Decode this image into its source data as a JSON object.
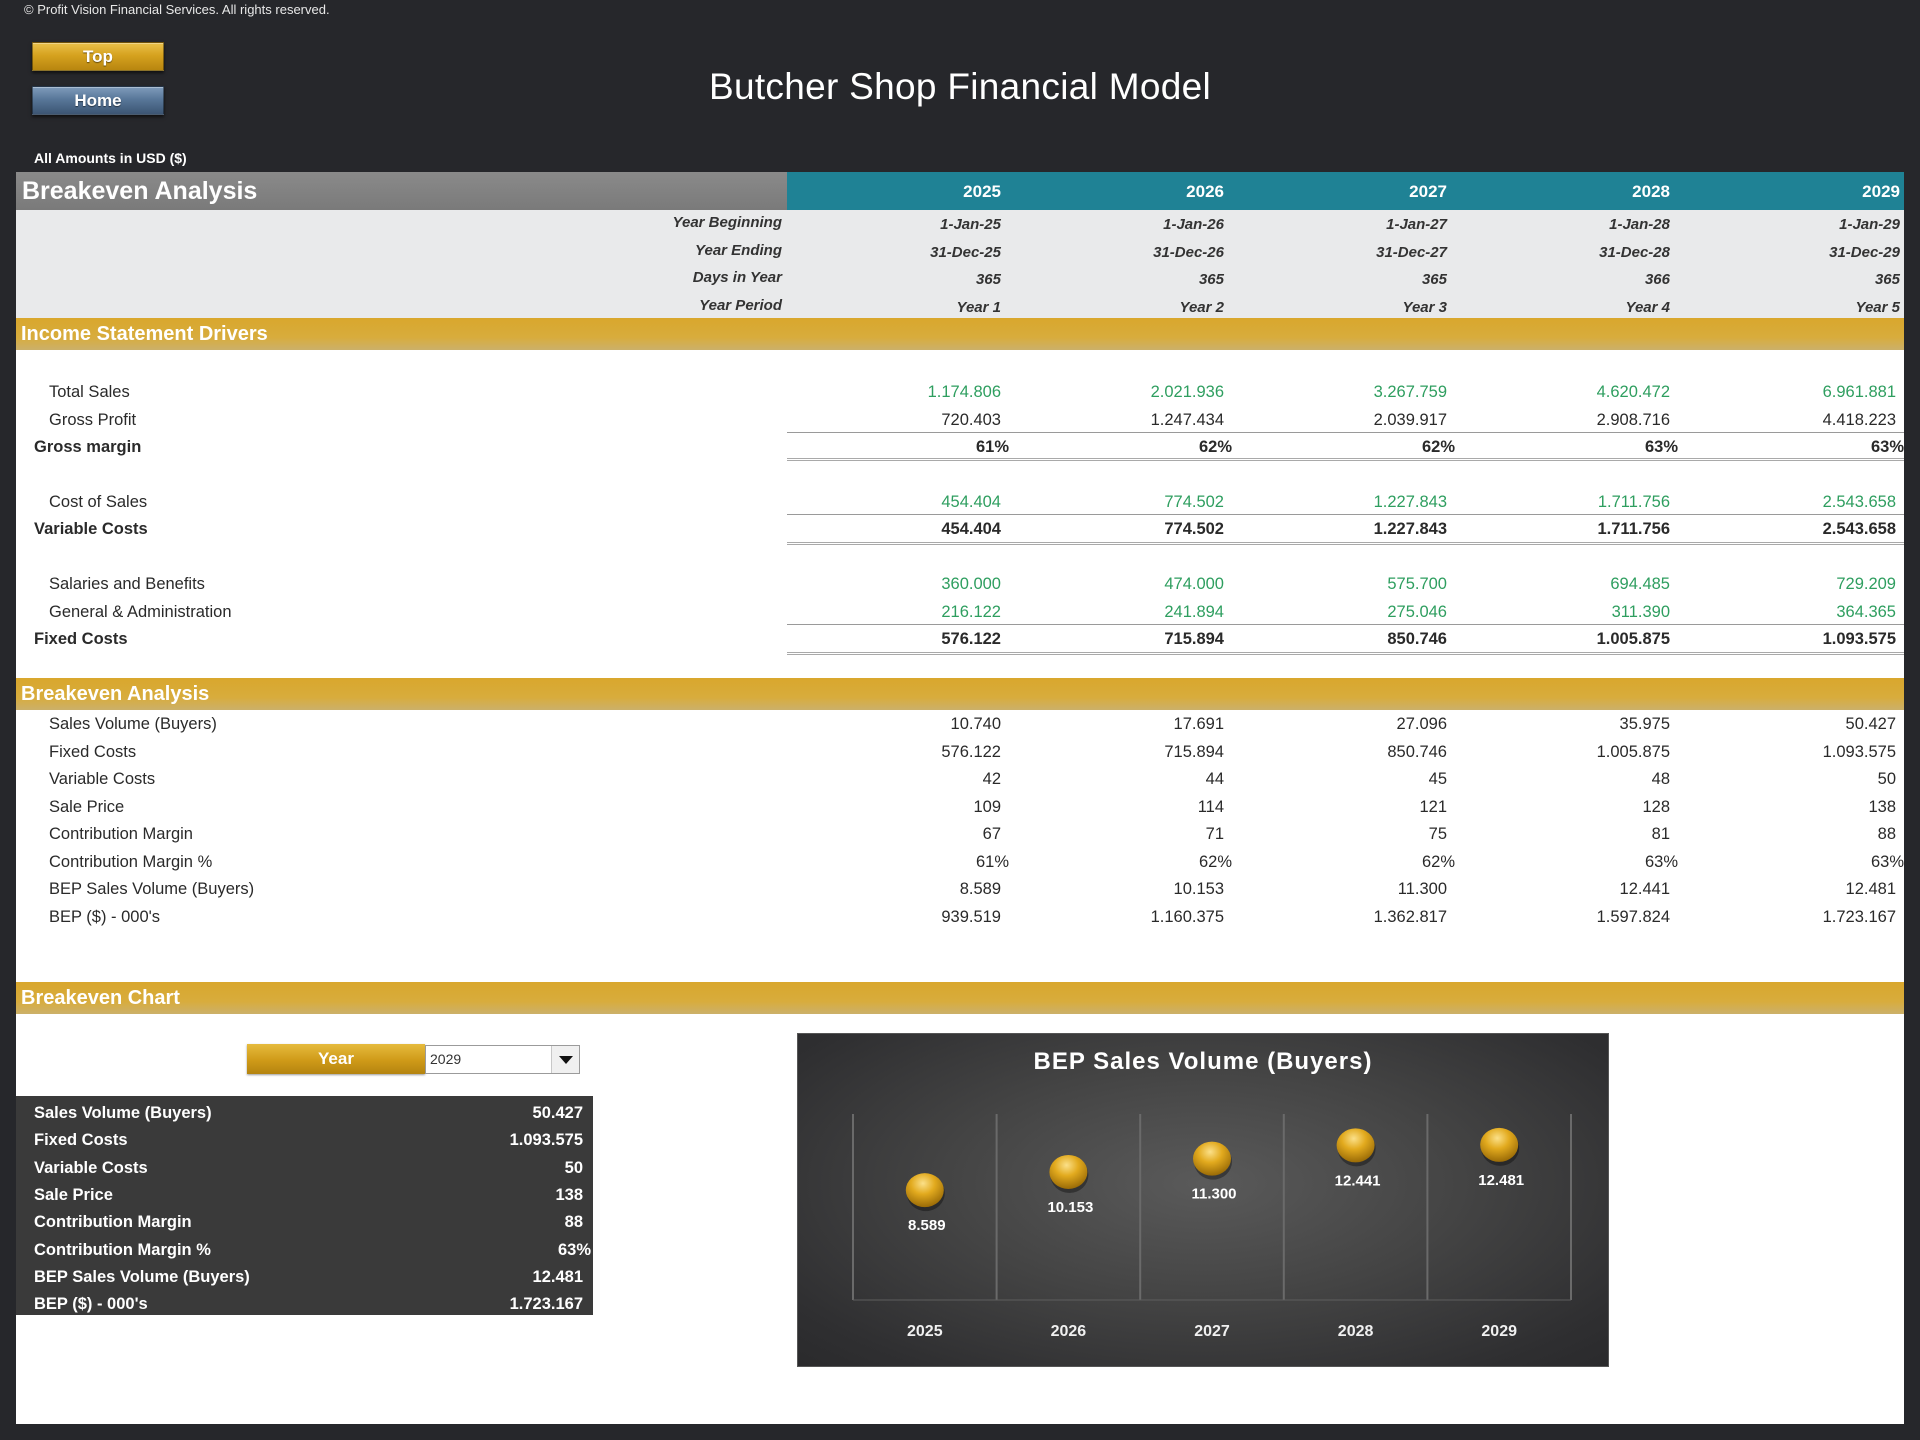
{
  "copyright": "© Profit Vision Financial Services. All rights reserved.",
  "nav": {
    "top_label": "Top",
    "home_label": "Home"
  },
  "title": "Butcher Shop Financial Model",
  "currency_note": "All Amounts in  USD ($)",
  "header": {
    "section_title": "Breakeven Analysis",
    "years": [
      "2025",
      "2026",
      "2027",
      "2028",
      "2029"
    ]
  },
  "period_info": [
    {
      "label": "Year Beginning",
      "values": [
        "1-Jan-25",
        "1-Jan-26",
        "1-Jan-27",
        "1-Jan-28",
        "1-Jan-29"
      ]
    },
    {
      "label": "Year Ending",
      "values": [
        "31-Dec-25",
        "31-Dec-26",
        "31-Dec-27",
        "31-Dec-28",
        "31-Dec-29"
      ]
    },
    {
      "label": "Days in Year",
      "values": [
        "365",
        "365",
        "365",
        "366",
        "365"
      ]
    },
    {
      "label": "Year Period",
      "values": [
        "Year 1",
        "Year 2",
        "Year 3",
        "Year 4",
        "Year 5"
      ]
    }
  ],
  "income_drivers": {
    "title": "Income Statement Drivers",
    "rows": [
      {
        "label": "Total Sales",
        "style": "input",
        "values": [
          "1.174.806",
          "2.021.936",
          "3.267.759",
          "4.620.472",
          "6.961.881"
        ]
      },
      {
        "label": "Gross Profit",
        "style": "normal",
        "values": [
          "720.403",
          "1.247.434",
          "2.039.917",
          "2.908.716",
          "4.418.223"
        ]
      },
      {
        "label": "Gross margin",
        "style": "total",
        "values": [
          "61%",
          "62%",
          "62%",
          "63%",
          "63%"
        ]
      },
      {
        "label": "Cost of Sales",
        "style": "input",
        "values": [
          "454.404",
          "774.502",
          "1.227.843",
          "1.711.756",
          "2.543.658"
        ]
      },
      {
        "label": "Variable Costs",
        "style": "total",
        "values": [
          "454.404",
          "774.502",
          "1.227.843",
          "1.711.756",
          "2.543.658"
        ]
      },
      {
        "label": "Salaries and Benefits",
        "style": "input",
        "values": [
          "360.000",
          "474.000",
          "575.700",
          "694.485",
          "729.209"
        ]
      },
      {
        "label": "General & Administration",
        "style": "input",
        "values": [
          "216.122",
          "241.894",
          "275.046",
          "311.390",
          "364.365"
        ]
      },
      {
        "label": "Fixed Costs",
        "style": "total",
        "values": [
          "576.122",
          "715.894",
          "850.746",
          "1.005.875",
          "1.093.575"
        ]
      }
    ]
  },
  "breakeven": {
    "title": "Breakeven Analysis",
    "rows": [
      {
        "label": "Sales Volume (Buyers)",
        "values": [
          "10.740",
          "17.691",
          "27.096",
          "35.975",
          "50.427"
        ]
      },
      {
        "label": "Fixed Costs",
        "values": [
          "576.122",
          "715.894",
          "850.746",
          "1.005.875",
          "1.093.575"
        ]
      },
      {
        "label": "Variable Costs",
        "values": [
          "42",
          "44",
          "45",
          "48",
          "50"
        ]
      },
      {
        "label": "Sale Price",
        "values": [
          "109",
          "114",
          "121",
          "128",
          "138"
        ]
      },
      {
        "label": "Contribution Margin",
        "values": [
          "67",
          "71",
          "75",
          "81",
          "88"
        ]
      },
      {
        "label": "Contribution Margin %",
        "values": [
          "61%",
          "62%",
          "62%",
          "63%",
          "63%"
        ]
      },
      {
        "label": "BEP Sales Volume (Buyers)",
        "values": [
          "8.589",
          "10.153",
          "11.300",
          "12.441",
          "12.481"
        ]
      },
      {
        "label": "BEP ($) - 000's",
        "values": [
          "939.519",
          "1.160.375",
          "1.362.817",
          "1.597.824",
          "1.723.167"
        ]
      }
    ]
  },
  "breakeven_chart_section": {
    "title": "Breakeven Chart",
    "year_button_label": "Year",
    "year_selected": "2029",
    "summary": [
      {
        "label": "Sales Volume (Buyers)",
        "value": "50.427"
      },
      {
        "label": "Fixed Costs",
        "value": "1.093.575"
      },
      {
        "label": "Variable Costs",
        "value": "50"
      },
      {
        "label": "Sale Price",
        "value": "138"
      },
      {
        "label": "Contribution Margin",
        "value": "88"
      },
      {
        "label": "Contribution Margin %",
        "value": "63%"
      },
      {
        "label": "BEP Sales Volume (Buyers)",
        "value": "12.481"
      },
      {
        "label": "BEP ($) - 000's",
        "value": "1.723.167"
      }
    ]
  },
  "colors": {
    "teal_header": "#1f8295",
    "gold_section": "#d9a72d",
    "input_green": "#2e9e5f",
    "marker_gold": "#e0a820"
  },
  "chart_data": {
    "type": "scatter",
    "title": "BEP Sales Volume (Buyers)",
    "categories": [
      "2025",
      "2026",
      "2027",
      "2028",
      "2029"
    ],
    "values": [
      8589,
      10153,
      11300,
      12441,
      12481
    ],
    "value_labels": [
      "8.589",
      "10.153",
      "11.300",
      "12.441",
      "12.481"
    ],
    "xlabel": "",
    "ylabel": "",
    "ylim": [
      0,
      16000
    ],
    "grid": "vertical",
    "legend": "none"
  }
}
